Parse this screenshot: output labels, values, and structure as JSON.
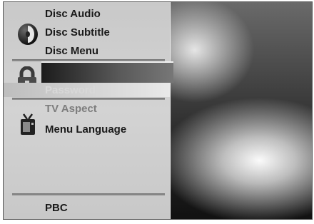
{
  "menu": {
    "disc_audio": "Disc Audio",
    "disc_subtitle": "Disc Subtitle",
    "disc_menu": "Disc Menu",
    "password": "Password",
    "tv_aspect": "TV Aspect",
    "menu_language": "Menu Language",
    "pbc": "PBC"
  },
  "icons": {
    "disc": "disc-icon",
    "lock": "lock-icon",
    "tv": "tv-icon"
  },
  "colors": {
    "panel": "#c9c9c9",
    "text": "#1a1a1a",
    "dim_text": "#7d7d7d",
    "selection": "#1c1c1c"
  }
}
